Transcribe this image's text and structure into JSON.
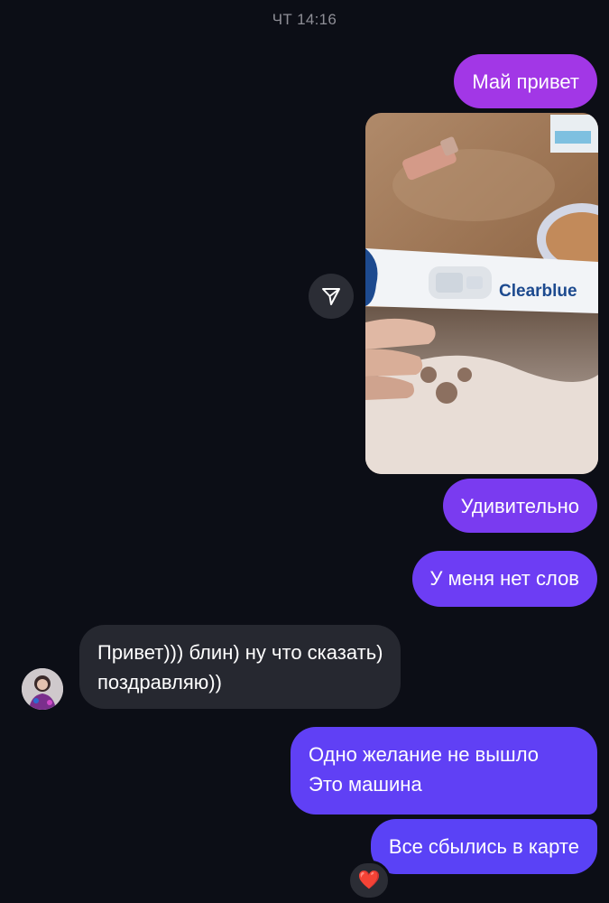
{
  "header": {
    "timestamp": "ЧТ 14:16"
  },
  "messages": [
    {
      "direction": "outgoing",
      "type": "text",
      "lines": [
        "Май привет"
      ]
    },
    {
      "direction": "outgoing",
      "type": "image",
      "image_text": "Clearblue"
    },
    {
      "direction": "outgoing",
      "type": "text",
      "lines": [
        "Удивительно"
      ]
    },
    {
      "direction": "outgoing",
      "type": "text",
      "lines": [
        "У меня нет слов"
      ]
    },
    {
      "direction": "incoming",
      "type": "text",
      "lines": [
        "Привет))) блин) ну что сказать)",
        "поздравляю))"
      ]
    },
    {
      "direction": "outgoing",
      "type": "text",
      "lines": [
        "Одно желание не вышло",
        "Это машина"
      ]
    },
    {
      "direction": "outgoing",
      "type": "text",
      "lines": [
        "Все сбылись в карте"
      ],
      "reaction": "❤️"
    }
  ],
  "icons": {
    "share": "paper-plane-icon",
    "avatar": "contact-avatar",
    "reaction": "heart-icon"
  },
  "colors": {
    "background": "#0c0e16",
    "incoming_bubble": "#262830",
    "outgoing_gradient_top": "#a237e6",
    "outgoing_gradient_bottom": "#5a42f6",
    "reaction_heart": "#e8242f"
  }
}
